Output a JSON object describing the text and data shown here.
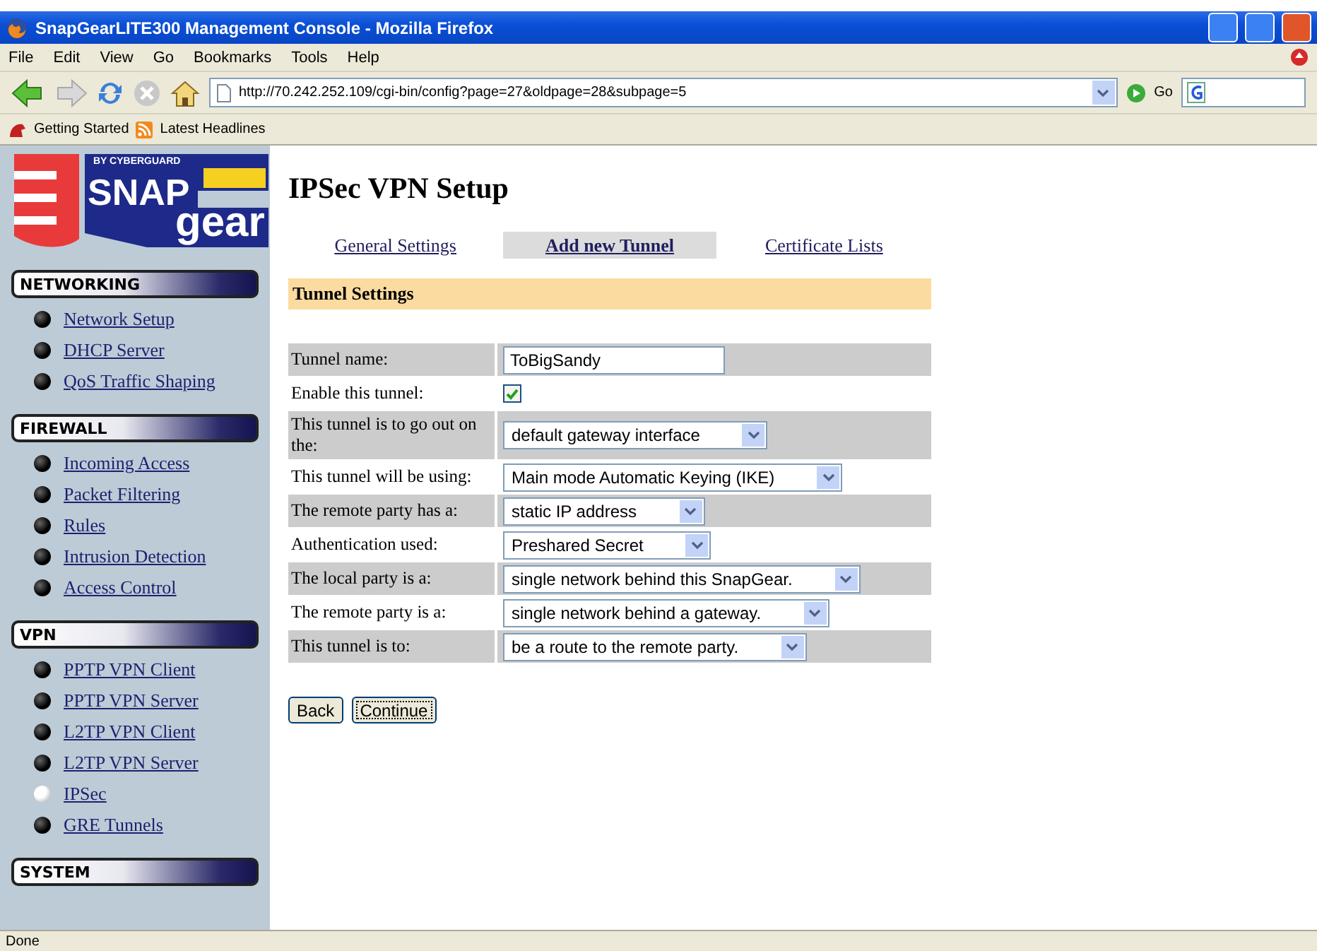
{
  "window": {
    "title": "SnapGearLITE300 Management Console - Mozilla Firefox"
  },
  "menu": [
    "File",
    "Edit",
    "View",
    "Go",
    "Bookmarks",
    "Tools",
    "Help"
  ],
  "address": {
    "url": "http://70.242.252.109/cgi-bin/config?page=27&oldpage=28&subpage=5",
    "go": "Go"
  },
  "bookmarks": [
    "Getting Started",
    "Latest Headlines"
  ],
  "logo": {
    "tagline": "BY CYBERGUARD",
    "word1": "SNAP",
    "word2": "gear"
  },
  "sidebar": [
    {
      "heading": "NETWORKING",
      "items": [
        {
          "label": "Network Setup",
          "selected": false
        },
        {
          "label": "DHCP Server",
          "selected": false
        },
        {
          "label": "QoS Traffic Shaping",
          "selected": false
        }
      ]
    },
    {
      "heading": "FIREWALL",
      "items": [
        {
          "label": "Incoming Access",
          "selected": false
        },
        {
          "label": "Packet Filtering",
          "selected": false
        },
        {
          "label": "Rules",
          "selected": false
        },
        {
          "label": "Intrusion Detection",
          "selected": false
        },
        {
          "label": "Access Control",
          "selected": false
        }
      ]
    },
    {
      "heading": "VPN",
      "items": [
        {
          "label": "PPTP VPN Client",
          "selected": false
        },
        {
          "label": "PPTP VPN Server",
          "selected": false
        },
        {
          "label": "L2TP VPN Client",
          "selected": false
        },
        {
          "label": "L2TP VPN Server",
          "selected": false
        },
        {
          "label": "IPSec",
          "selected": true
        },
        {
          "label": "GRE Tunnels",
          "selected": false
        }
      ]
    },
    {
      "heading": "SYSTEM"
    }
  ],
  "page_title": "IPSec VPN Setup",
  "tabs": [
    {
      "label": "General Settings",
      "selected": false
    },
    {
      "label": "Add new Tunnel",
      "selected": true
    },
    {
      "label": "Certificate Lists",
      "selected": false
    }
  ],
  "section": "Tunnel Settings",
  "rows": [
    {
      "kind": "text",
      "label": "Tunnel name:",
      "value": "ToBigSandy"
    },
    {
      "kind": "checkbox",
      "label": "Enable this tunnel:",
      "checked": true
    },
    {
      "kind": "select",
      "label": "This tunnel is to go out on the:",
      "value": "default gateway interface"
    },
    {
      "kind": "select",
      "label": "This tunnel will be using:",
      "value": "Main mode Automatic Keying (IKE)"
    },
    {
      "kind": "select",
      "label": "The remote party has a:",
      "value": "static IP address"
    },
    {
      "kind": "select",
      "label": "Authentication used:",
      "value": "Preshared Secret"
    },
    {
      "kind": "select",
      "label": "The local party is a:",
      "value": "single network behind this SnapGear."
    },
    {
      "kind": "select",
      "label": "The remote party is a:",
      "value": "single network behind a gateway."
    },
    {
      "kind": "select",
      "label": "This tunnel is to:",
      "value": "be a route to the remote party."
    }
  ],
  "buttons": [
    {
      "label": "Back",
      "focused": false
    },
    {
      "label": "Continue",
      "focused": true
    }
  ],
  "status_bar": "Done"
}
